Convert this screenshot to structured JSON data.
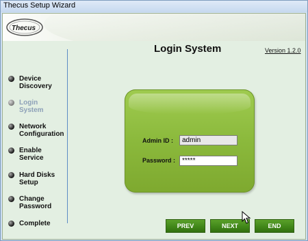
{
  "window": {
    "title": "Thecus Setup Wizard"
  },
  "logo": {
    "text": "Thecus"
  },
  "sidebar": {
    "items": [
      {
        "label1": "Device",
        "label2": "Discovery",
        "active": false
      },
      {
        "label1": "Login",
        "label2": "System",
        "active": true
      },
      {
        "label1": "Network",
        "label2": "Configuration",
        "active": false
      },
      {
        "label1": "Enable",
        "label2": "Service",
        "active": false
      },
      {
        "label1": "Hard Disks",
        "label2": "Setup",
        "active": false
      },
      {
        "label1": "Change",
        "label2": "Password",
        "active": false
      },
      {
        "label1": "Complete",
        "label2": "",
        "active": false
      }
    ]
  },
  "header": {
    "title": "Login System",
    "version": "Version 1.2.0"
  },
  "form": {
    "admin_label": "Admin ID :",
    "admin_value": "admin",
    "password_label": "Password :",
    "password_value": "*****"
  },
  "buttons": {
    "prev": "PREV",
    "next": "NEXT",
    "end": "END"
  },
  "colors": {
    "panel": "#8bb93c",
    "button": "#3f8518",
    "background": "#e3efe2"
  }
}
